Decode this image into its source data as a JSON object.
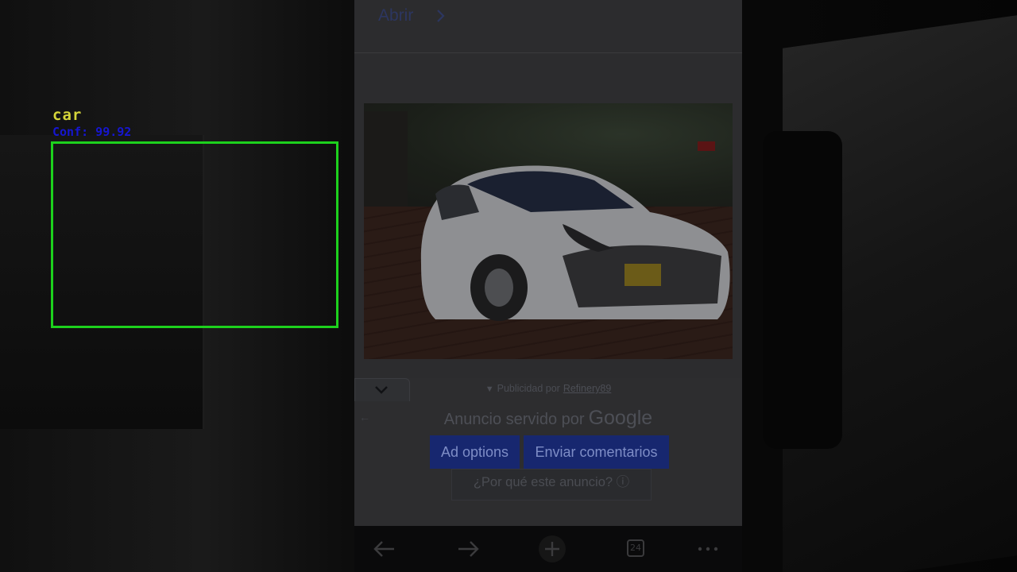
{
  "page": {
    "open_link": "Abrir",
    "detection": {
      "class_label": "car",
      "confidence_label": "Conf: 99.92",
      "box_color": "#1dd11d",
      "label_color": "#d5d53a",
      "conf_color": "#1616d0"
    },
    "ad_attribution": {
      "marker": "▼",
      "prefix": "Publicidad por",
      "brand": "Refinery89"
    },
    "served_by": {
      "label": "Anuncio servido por",
      "brand": "Google"
    },
    "buttons": {
      "ad_options": "Ad options",
      "feedback": "Enviar comentarios"
    },
    "why_ad": "¿Por qué este anuncio? ⓘ",
    "browser_toolbar": {
      "tab_count": "24",
      "icons": [
        "back-arrow-icon",
        "forward-arrow-icon",
        "new-tab-plus-icon",
        "tabs-counter-icon",
        "more-menu-icon"
      ]
    },
    "colors": {
      "button_bg": "#17276f",
      "link": "#2c3660"
    }
  }
}
